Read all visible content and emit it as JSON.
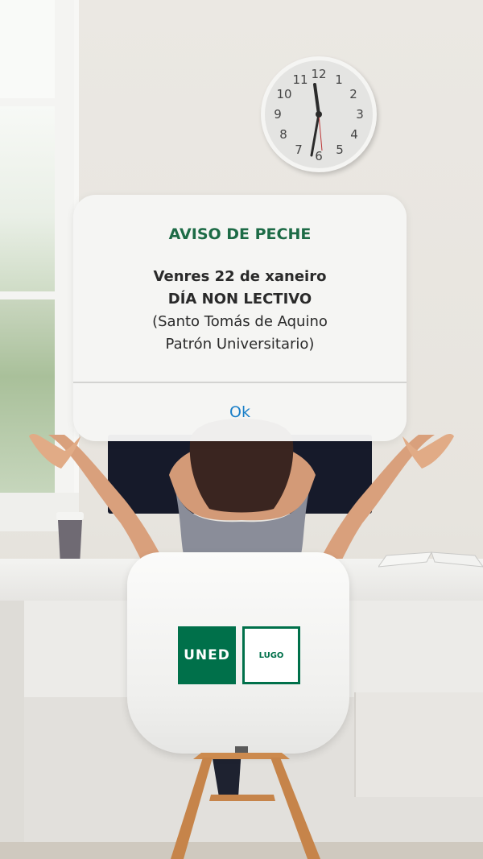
{
  "dialog": {
    "title": "AVISO DE PECHE",
    "line1": "Venres 22 de xaneiro",
    "line2": "DÍA NON LECTIVO",
    "line3": "(Santo Tomás de Aquino",
    "line4": "Patrón Universitario)",
    "ok_label": "Ok"
  },
  "clock": {
    "numerals": [
      "12",
      "1",
      "2",
      "3",
      "4",
      "5",
      "6",
      "7",
      "8",
      "9",
      "10",
      "11"
    ]
  },
  "logo": {
    "brand_text": "UNED",
    "campus_text": "LUGO"
  },
  "colors": {
    "brand_green": "#00704a",
    "title_green": "#1d6b46",
    "action_blue": "#1a7fc8"
  },
  "icons": [
    "wall-clock-icon"
  ]
}
